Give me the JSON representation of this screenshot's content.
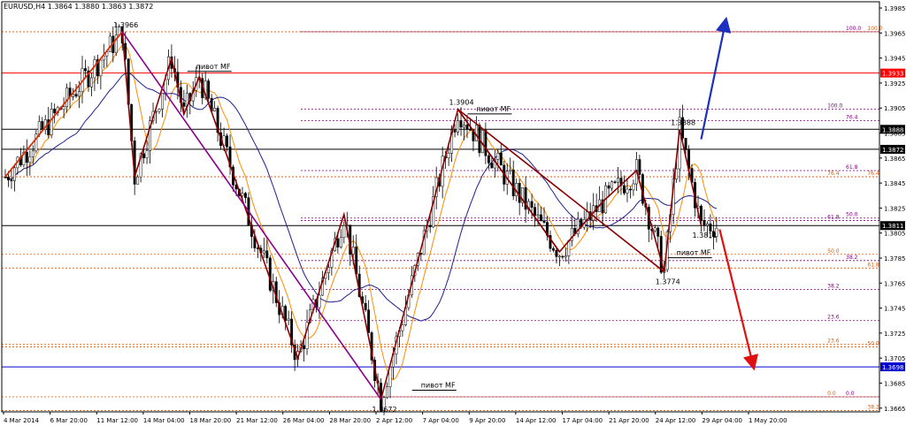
{
  "window": {
    "title": "EURUSD,H4  1.3864 1.3880 1.3863 1.3872"
  },
  "colors": {
    "background": "#ffffff",
    "bull_candle": "#000000",
    "bear_candle": "#000000",
    "ma_fast": "#ff8c00",
    "ma_slow": "#1f1f8f",
    "zigzag": "#8b0000",
    "zigzag_outer": "#8b008b",
    "fib_orange": "#e05a00",
    "fib_purple": "#800080",
    "red_level": "#ff0000",
    "blue_level": "#0000cd",
    "black_level": "#000000",
    "up_arrow": "#1c2fbf",
    "down_arrow": "#e01010"
  },
  "chart_data": {
    "type": "candlestick",
    "symbol": "EURUSD",
    "timeframe": "H4",
    "ohlc_current": {
      "open": 1.3864,
      "high": 1.388,
      "low": 1.3863,
      "close": 1.3872
    },
    "ylim": [
      1.3662,
      1.399
    ],
    "y_ticks": [
      "1.3985",
      "1.3965",
      "1.3945",
      "1.3925",
      "1.3905",
      "1.3885",
      "1.3865",
      "1.3845",
      "1.3825",
      "1.3805",
      "1.3785",
      "1.3765",
      "1.3745",
      "1.3725",
      "1.3705",
      "1.3685",
      "1.3665"
    ],
    "x_ticks": [
      "4 Mar 2014",
      "6 Mar 20:00",
      "11 Mar 12:00",
      "14 Mar 04:00",
      "18 Mar 20:00",
      "21 Mar 12:00",
      "26 Mar 04:00",
      "28 Mar 20:00",
      "2 Apr 12:00",
      "7 Apr 04:00",
      "9 Apr 20:00",
      "14 Apr 12:00",
      "17 Apr 04:00",
      "21 Apr 20:00",
      "24 Apr 12:00",
      "29 Apr 04:00",
      "1 May 20:00"
    ],
    "price_tags": [
      {
        "value": 1.3933,
        "label": "1.3933",
        "color": "#ff0000"
      },
      {
        "value": 1.3888,
        "label": "1.3888",
        "color": "#000000"
      },
      {
        "value": 1.3872,
        "label": "1.3872",
        "color": "#000000"
      },
      {
        "value": 1.3811,
        "label": "1.3811",
        "color": "#000000"
      },
      {
        "value": 1.3698,
        "label": "1.3698",
        "color": "#0000cd"
      }
    ],
    "swing_points": [
      {
        "label": "1.3966",
        "value": 1.3966,
        "bar": 38
      },
      {
        "label": "1.3904",
        "value": 1.3904,
        "bar": 147
      },
      {
        "label": "1.3888",
        "value": 1.3888,
        "bar": 219
      },
      {
        "label": "1.3811",
        "value": 1.3811,
        "bar": 226
      },
      {
        "label": "1.3774",
        "value": 1.3774,
        "bar": 214
      },
      {
        "label": "1.3672",
        "value": 1.3672,
        "bar": 122
      }
    ],
    "pivot_labels": [
      {
        "text": "пивот MF",
        "value": 1.3935,
        "bar": 62
      },
      {
        "text": "пивот MF",
        "value": 1.3901,
        "bar": 153
      },
      {
        "text": "пивот MF",
        "value": 1.3786,
        "bar": 218
      },
      {
        "text": "пивот MF",
        "value": 1.368,
        "bar": 135
      }
    ],
    "fib_levels": [
      {
        "label": "100.0",
        "value": 1.3966,
        "color": "#e05a00",
        "text_bar": 280
      },
      {
        "label": "100.0",
        "value": 1.3966,
        "color": "#800080",
        "text_bar": 273
      },
      {
        "label": "100.0",
        "value": 1.3904,
        "color": "#800080",
        "text_bar": 267
      },
      {
        "label": "76.4",
        "value": 1.3895,
        "color": "#800080",
        "text_bar": 273
      },
      {
        "label": "61.8",
        "value": 1.3855,
        "color": "#800080",
        "text_bar": 273
      },
      {
        "label": "76.4",
        "value": 1.385,
        "color": "#e05a00",
        "text_bar": 267
      },
      {
        "label": "76.4",
        "value": 1.385,
        "color": "#e05a00",
        "text_bar": 280
      },
      {
        "label": "61.8",
        "value": 1.3815,
        "color": "#800080",
        "text_bar": 267
      },
      {
        "label": "50.0",
        "value": 1.3817,
        "color": "#800080",
        "text_bar": 273
      },
      {
        "label": "50.0",
        "value": 1.3788,
        "color": "#e05a00",
        "text_bar": 267
      },
      {
        "label": "38.2",
        "value": 1.3783,
        "color": "#800080",
        "text_bar": 273
      },
      {
        "label": "61.8",
        "value": 1.3777,
        "color": "#e05a00",
        "text_bar": 280
      },
      {
        "label": "38.2",
        "value": 1.376,
        "color": "#800080",
        "text_bar": 267
      },
      {
        "label": "23.6",
        "value": 1.3735,
        "color": "#800080",
        "text_bar": 267
      },
      {
        "label": "23.6",
        "value": 1.3716,
        "color": "#e05a00",
        "text_bar": 267
      },
      {
        "label": "50.0",
        "value": 1.3714,
        "color": "#e05a00",
        "text_bar": 280
      },
      {
        "label": "0.0",
        "value": 1.3674,
        "color": "#e05a00",
        "text_bar": 267
      },
      {
        "label": "0.0",
        "value": 1.3674,
        "color": "#800080",
        "text_bar": 273
      },
      {
        "label": "38.2",
        "value": 1.3663,
        "color": "#e05a00",
        "text_bar": 280
      }
    ],
    "zigzag_points": [
      [
        0,
        1.385
      ],
      [
        38,
        1.3966
      ],
      [
        42,
        1.385
      ],
      [
        54,
        1.3945
      ],
      [
        58,
        1.39
      ],
      [
        63,
        1.393
      ],
      [
        95,
        1.3705
      ],
      [
        110,
        1.382
      ],
      [
        122,
        1.3672
      ],
      [
        147,
        1.3904
      ],
      [
        180,
        1.379
      ],
      [
        194,
        1.383
      ],
      [
        205,
        1.3855
      ],
      [
        214,
        1.3774
      ],
      [
        219,
        1.3888
      ],
      [
        226,
        1.3811
      ]
    ],
    "outer_lines": [
      {
        "from": [
          0,
          1.385
        ],
        "to": [
          38,
          1.3966
        ],
        "color": "#e03000"
      },
      {
        "from": [
          38,
          1.3966
        ],
        "to": [
          122,
          1.3672
        ],
        "color": "#8b008b"
      },
      {
        "from": [
          147,
          1.3904
        ],
        "to": [
          214,
          1.3774
        ],
        "color": "#8b0000"
      },
      {
        "from": [
          147,
          1.3904
        ],
        "to": [
          180,
          1.379
        ],
        "color": "#8b0000"
      }
    ],
    "projections": [
      {
        "direction": "up",
        "from": [
          226,
          1.388
        ],
        "to": [
          234,
          1.3975
        ],
        "color": "#1c2fbf"
      },
      {
        "direction": "down",
        "from": [
          232,
          1.3808
        ],
        "to": [
          243,
          1.3698
        ],
        "color": "#e01010"
      }
    ],
    "bars": 232
  }
}
